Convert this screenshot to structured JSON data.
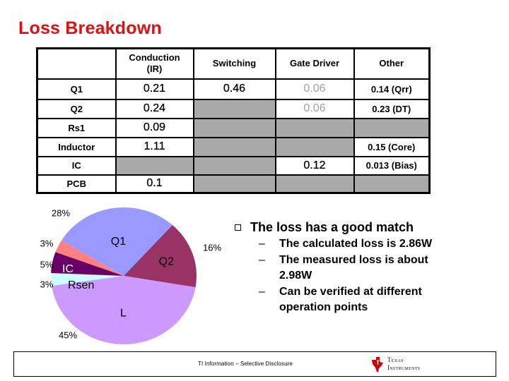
{
  "slide": {
    "title": "Loss Breakdown",
    "title_color": "#e01010"
  },
  "table": {
    "headers": [
      "",
      "Conduction (IR)",
      "Switching",
      "Gate Driver",
      "Other"
    ],
    "rows": [
      {
        "label": "Q1",
        "conduction": "0.21",
        "switching": "0.46",
        "gate_driver": "0.06",
        "other": "0.14 (Qrr)"
      },
      {
        "label": "Q2",
        "conduction": "0.24",
        "switching": "",
        "gate_driver": "0.06",
        "other": "0.23 (DT)"
      },
      {
        "label": "Rs1",
        "conduction": "0.09",
        "switching": "",
        "gate_driver": "",
        "other": ""
      },
      {
        "label": "Inductor",
        "conduction": "1.11",
        "switching": "",
        "gate_driver": "",
        "other": "0.15 (Core)"
      },
      {
        "label": "IC",
        "conduction": "",
        "switching": "",
        "gate_driver": "0.12",
        "other": "0.013 (Bias)"
      },
      {
        "label": "PCB",
        "conduction": "0.1",
        "switching": "",
        "gate_driver": "",
        "other": ""
      }
    ],
    "empty_cell_color": "#a9a9a9"
  },
  "chart_data": {
    "type": "pie",
    "title": "",
    "slices": [
      {
        "name": "Q2",
        "label": "Q2",
        "value": 16,
        "pct_label": "16%",
        "color": "#993366"
      },
      {
        "name": "L",
        "label": "L",
        "value": 45,
        "pct_label": "45%",
        "color": "#cc99ff"
      },
      {
        "name": "Rsen",
        "label": "Rsen",
        "value": 3,
        "pct_label": "3%",
        "color": "#ccffff"
      },
      {
        "name": "IC",
        "label": "IC",
        "value": 5,
        "pct_label": "5%",
        "color": "#660066"
      },
      {
        "name": "Other",
        "label": "",
        "value": 3,
        "pct_label": "3%",
        "color": "#ff8080"
      },
      {
        "name": "Q1",
        "label": "Q1",
        "value": 28,
        "pct_label": "28%",
        "color": "#9999ff"
      }
    ],
    "start_angle_deg": -48,
    "direction": "clockwise",
    "legend": "none"
  },
  "bullets": {
    "main": "The loss has a good match",
    "sub": [
      "The calculated loss is 2.86W",
      "The measured loss is about 2.98W",
      "Can be verified at different operation points"
    ]
  },
  "footer": {
    "disclosure": "TI Information – Selective Disclosure",
    "logo_line1": "Texas",
    "logo_line2": "Instruments",
    "logo_color": "#cc0000"
  }
}
